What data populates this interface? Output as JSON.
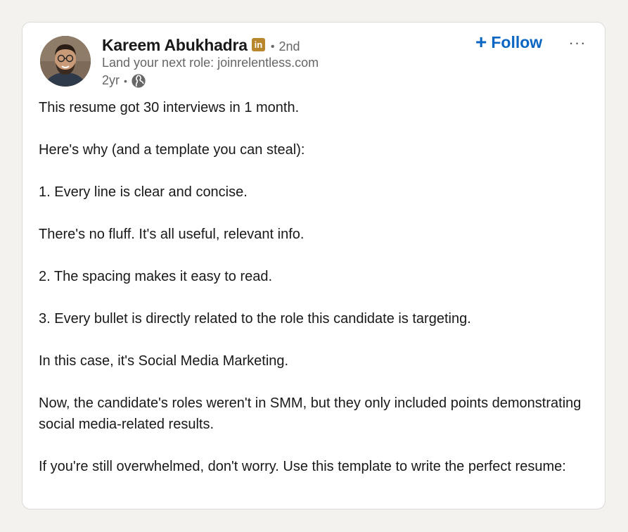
{
  "author": {
    "name": "Kareem Abukhadra",
    "badge": "in",
    "degree": "2nd",
    "headline": "Land your next role: joinrelentless.com",
    "time": "2yr",
    "separator": "•",
    "visibility_icon": "globe-icon"
  },
  "actions": {
    "follow_plus": "+",
    "follow_label": "Follow",
    "more_label": "···"
  },
  "post": {
    "paragraphs": [
      "This resume got 30 interviews in 1 month.",
      "Here's why (and a template you can steal):",
      "1. Every line is clear and concise.",
      "There's no fluff. It's all useful, relevant info.",
      "2. The spacing makes it easy to read.",
      "3. Every bullet is directly related to the role this candidate is targeting.",
      "In this case, it's Social Media Marketing.",
      "Now, the candidate's roles weren't in SMM, but they only included points demonstrating social media-related results.",
      "If you're still overwhelmed, don't worry. Use this template to write the perfect resume:"
    ]
  },
  "colors": {
    "accent": "#0a66c2",
    "badge": "#b8862d",
    "text": "#191919",
    "muted": "#666666",
    "background": "#f3f2ef"
  }
}
